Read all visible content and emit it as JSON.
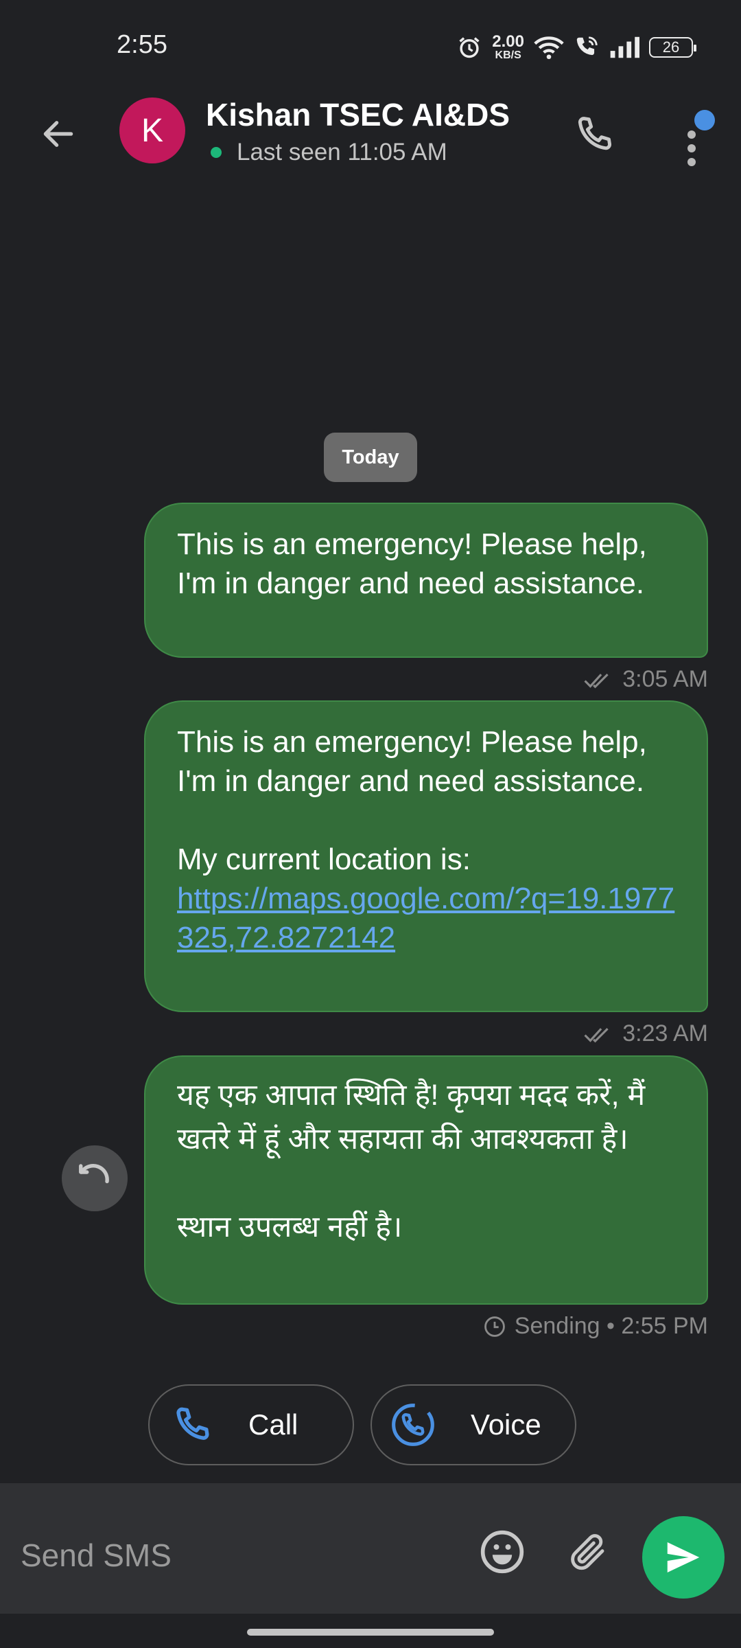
{
  "status_bar": {
    "time": "2:55",
    "net_speed_value": "2.00",
    "net_speed_unit": "KB/S",
    "battery": "26",
    "icons": [
      "alarm-icon",
      "wifi-icon",
      "wifi-calling-icon",
      "signal-icon",
      "battery-icon"
    ]
  },
  "header": {
    "avatar_letter": "K",
    "avatar_color": "#c2185b",
    "contact_name": "Kishan TSEC AI&DS",
    "last_seen": "Last seen 11:05 AM",
    "online_color": "#1db87a"
  },
  "conversation": {
    "date_chip": "Today",
    "messages": [
      {
        "text": "This is an emergency! Please help, I'm in danger and need assistance.",
        "status_icon": "double-check-icon",
        "meta": "3:05 AM"
      },
      {
        "text": "This is an emergency! Please help, I'm in danger and need assistance.\n\nMy current location is:",
        "link": "https://maps.google.com/?q=19.1977325,72.8272142",
        "status_icon": "double-check-icon",
        "meta": "3:23 AM"
      },
      {
        "text": "यह एक आपात स्थिति है! कृपया मदद करें, मैं खतरे में हूं और सहायता की आवश्यकता है।\n\nस्थान उपलब्ध नहीं है।",
        "status_icon": "clock-icon",
        "meta": "Sending • 2:55 PM"
      }
    ],
    "bubble_color": "#336d39"
  },
  "quick_actions": {
    "call_label": "Call",
    "voice_label": "Voice",
    "icon_color": "#4a90e2"
  },
  "composer": {
    "placeholder": "Send SMS",
    "send_color": "#1db86e"
  }
}
